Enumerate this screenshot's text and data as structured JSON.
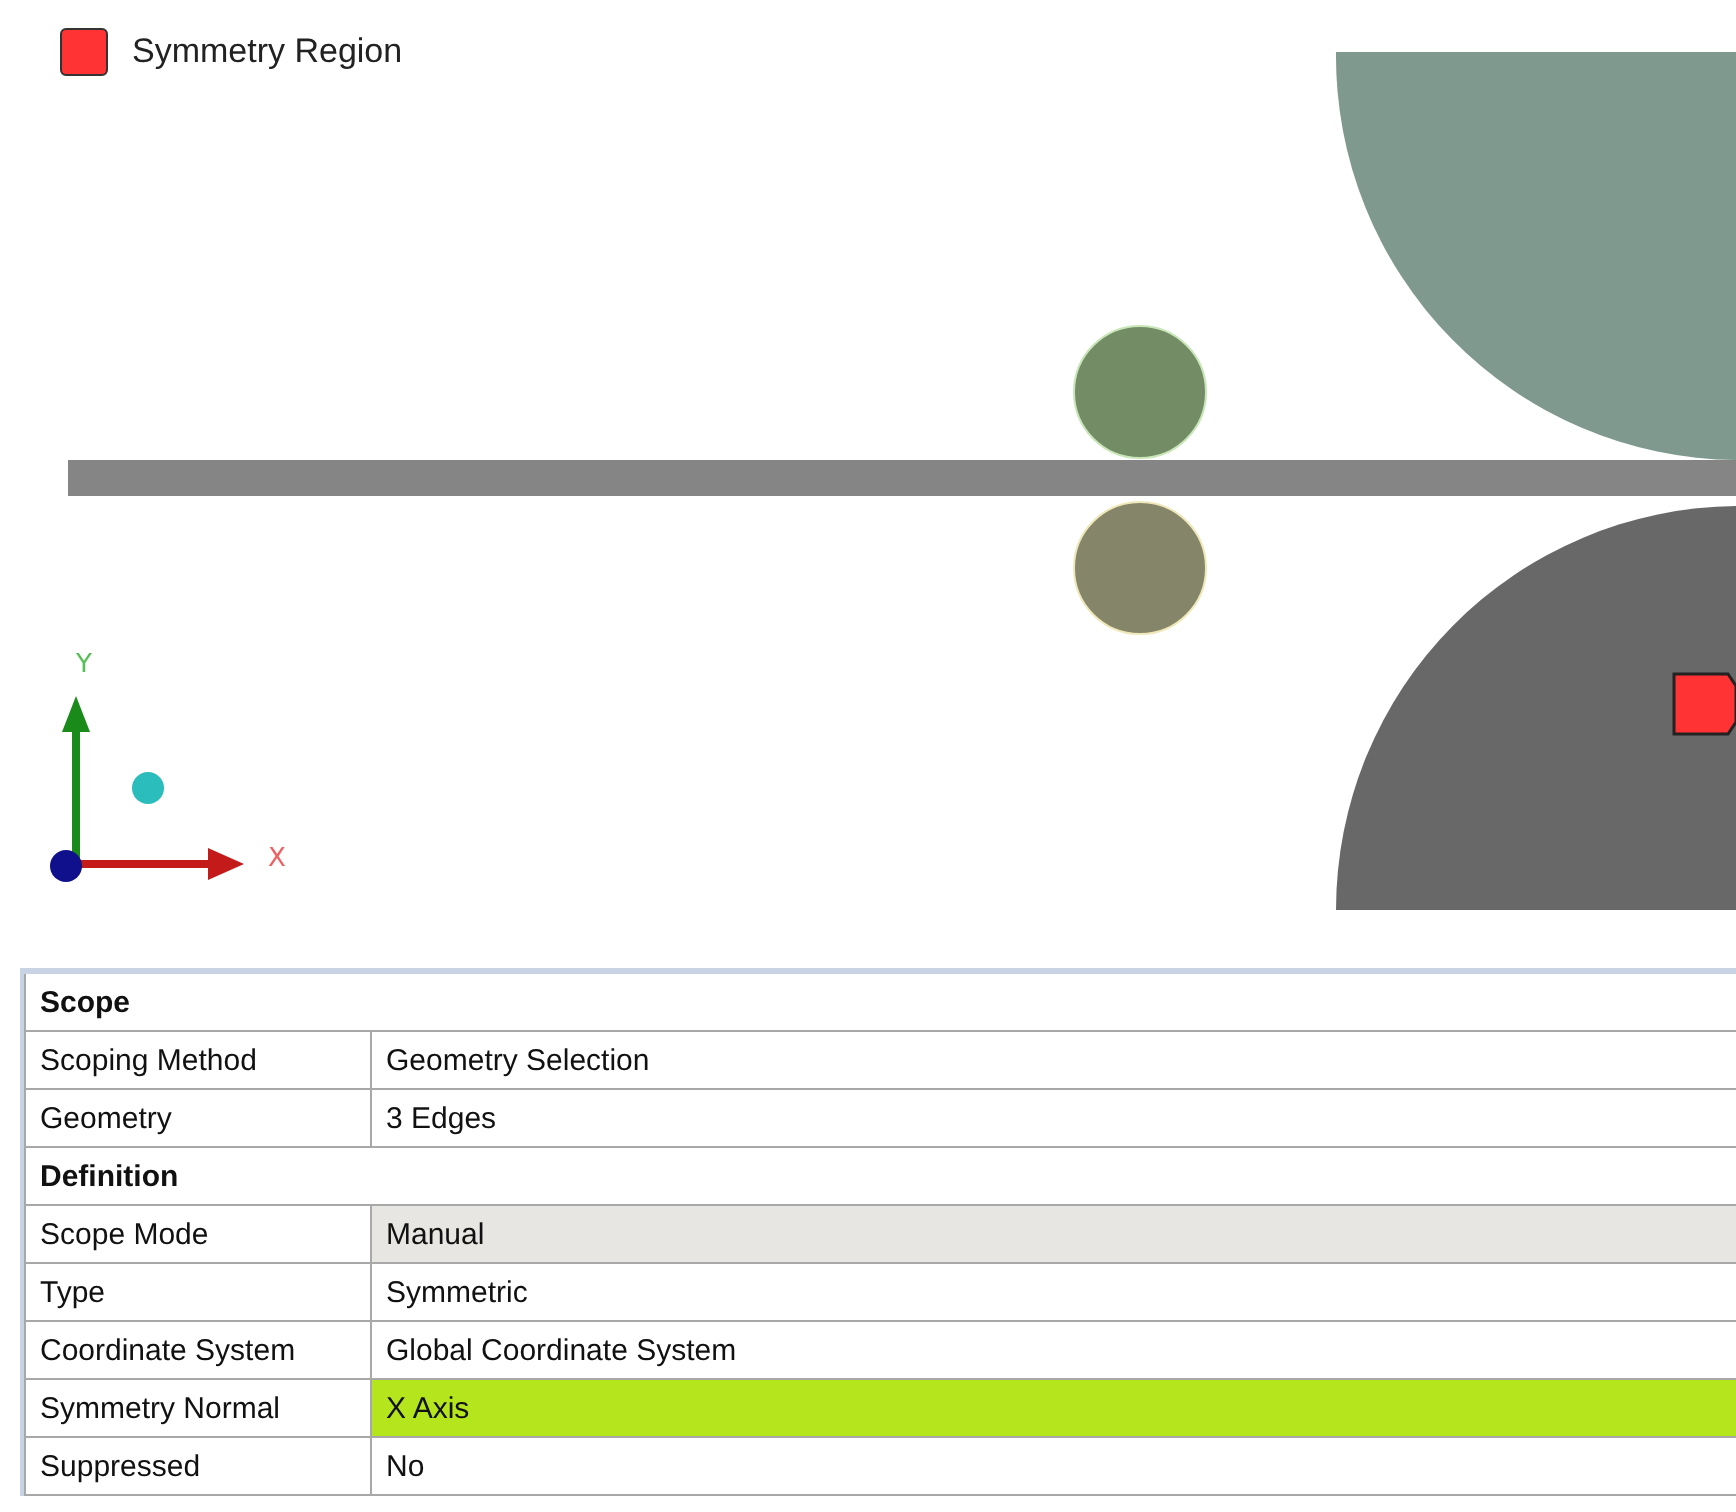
{
  "legend": {
    "label": "Symmetry Region",
    "color": "#ff3333"
  },
  "triad": {
    "x_label": "X",
    "y_label": "Y"
  },
  "details": [
    {
      "kind": "header",
      "label": "Scope"
    },
    {
      "kind": "property",
      "label": "Scoping Method",
      "value": "Geometry Selection",
      "readonly": false,
      "highlighted": false
    },
    {
      "kind": "property",
      "label": "Geometry",
      "value": "3 Edges",
      "readonly": false,
      "highlighted": false
    },
    {
      "kind": "header",
      "label": "Definition"
    },
    {
      "kind": "property",
      "label": "Scope Mode",
      "value": "Manual",
      "readonly": true,
      "highlighted": false
    },
    {
      "kind": "property",
      "label": "Type",
      "value": "Symmetric",
      "readonly": false,
      "highlighted": false
    },
    {
      "kind": "property",
      "label": "Coordinate System",
      "value": "Global Coordinate System",
      "readonly": false,
      "highlighted": false
    },
    {
      "kind": "property",
      "label": "Symmetry Normal",
      "value": "X Axis",
      "readonly": false,
      "highlighted": true
    },
    {
      "kind": "property",
      "label": "Suppressed",
      "value": "No",
      "readonly": false,
      "highlighted": false
    }
  ]
}
